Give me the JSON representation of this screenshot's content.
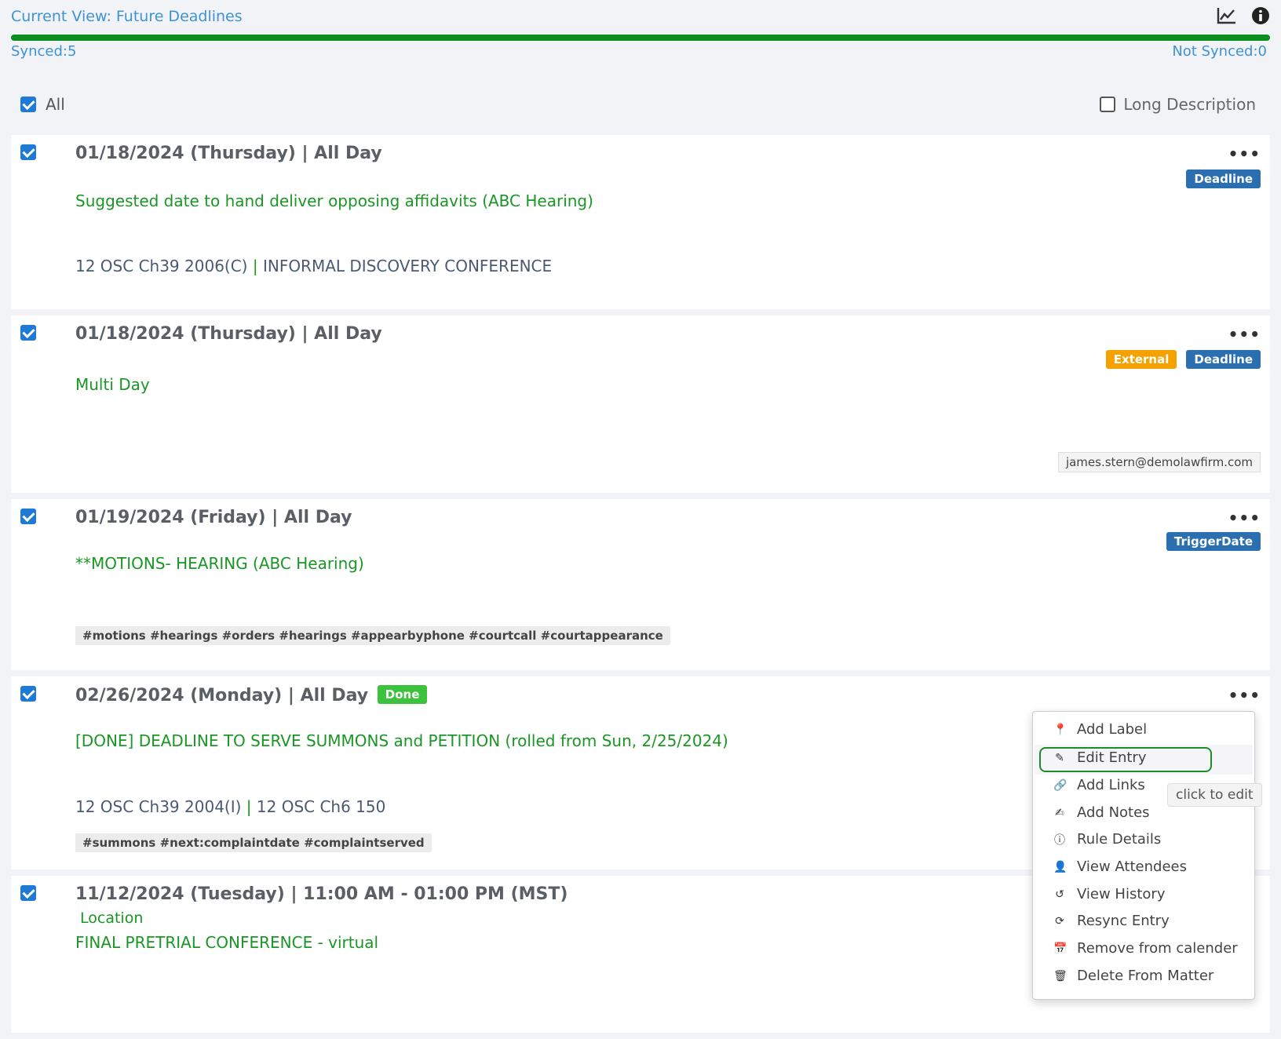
{
  "header": {
    "current_view": "Current View: Future Deadlines",
    "chart_icon": "line-chart-icon",
    "info_icon": "info-icon",
    "progress": 1.0,
    "synced": "Synced:5",
    "not_synced": "Not Synced:0"
  },
  "controls": {
    "all_label": "All",
    "all_checked": true,
    "long_description_label": "Long Description",
    "long_description_checked": false
  },
  "entries": [
    {
      "date": "01/18/2024 (Thursday)  |  All Day",
      "title": "Suggested date to hand deliver opposing affidavits (ABC Hearing)",
      "rule_a": "12 OSC Ch39 2006(C)",
      "rule_sep": "|",
      "rule_b": "INFORMAL DISCOVERY CONFERENCE",
      "badges": [
        "Deadline"
      ]
    },
    {
      "date": "01/18/2024 (Thursday)  |  All Day",
      "title": "Multi Day",
      "badges": [
        "External",
        "Deadline"
      ],
      "email": "james.stern@demolawfirm.com"
    },
    {
      "date": "01/19/2024 (Friday)  |  All Day",
      "title": "**MOTIONS- HEARING (ABC Hearing)",
      "badges": [
        "TriggerDate"
      ],
      "tags": "#motions #hearings #orders #hearings #appearbyphone #courtcall #courtappearance"
    },
    {
      "date": "02/26/2024 (Monday)  |  All Day",
      "done_badge": "Done",
      "title": "[DONE] DEADLINE TO SERVE SUMMONS and PETITION (rolled from Sun, 2/25/2024)",
      "rule_a": "12 OSC Ch39 2004(I)",
      "rule_sep": "|",
      "rule_b": "12 OSC Ch6 150",
      "tags": "#summons #next:complaintdate #complaintserved"
    },
    {
      "date": "11/12/2024 (Tuesday)  |  11:00 AM - 01:00 PM (MST)",
      "location": "Location",
      "title": "FINAL PRETRIAL CONFERENCE - virtual"
    }
  ],
  "context_menu": {
    "items": [
      {
        "label": "Add Label",
        "icon": "pin-icon"
      },
      {
        "label": "Edit Entry",
        "icon": "pencil-icon"
      },
      {
        "label": "Add Links",
        "icon": "link-icon"
      },
      {
        "label": "Add Notes",
        "icon": "edit-note-icon"
      },
      {
        "label": "Rule Details",
        "icon": "info-icon"
      },
      {
        "label": "View Attendees",
        "icon": "user-icon"
      },
      {
        "label": "View History",
        "icon": "history-icon"
      },
      {
        "label": "Resync Entry",
        "icon": "refresh-icon"
      },
      {
        "label": "Remove from calender",
        "icon": "calendar-remove-icon"
      },
      {
        "label": "Delete From Matter",
        "icon": "trash-icon"
      }
    ],
    "tooltip": "click to edit"
  },
  "colors": {
    "link": "#3d93d4",
    "progress": "#0a8f1e",
    "title_green": "#1a9625",
    "badge_blue": "#2b6fb0",
    "badge_orange": "#f5a100",
    "badge_done": "#3cc23c"
  }
}
